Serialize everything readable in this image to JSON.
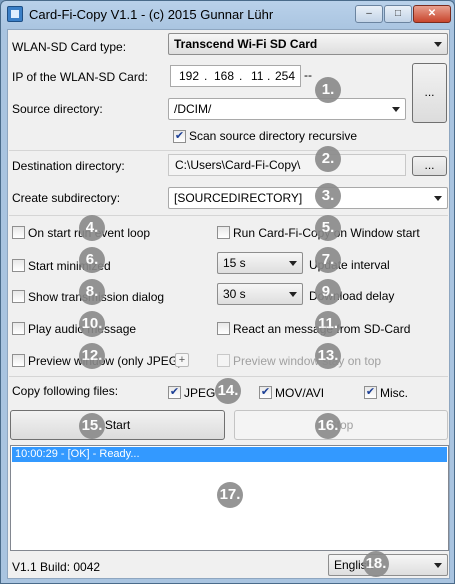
{
  "window": {
    "title": "Card-Fi-Copy V1.1 - (c) 2015 Gunnar Lühr"
  },
  "titlebar": {
    "minimize": "–",
    "maximize": "□",
    "close": "✕"
  },
  "card_type": {
    "label": "WLAN-SD Card type:",
    "value": "Transcend Wi-Fi SD Card"
  },
  "ip": {
    "label": "IP of the WLAN-SD Card:",
    "octets": [
      "192",
      "168",
      "11",
      "254"
    ],
    "dots": ".",
    "suffix": "--"
  },
  "side_button": {
    "label": "..."
  },
  "source": {
    "label": "Source directory:",
    "value": "/DCIM/"
  },
  "scan_recursive": {
    "label": "Scan source directory recursive",
    "checked": true
  },
  "destination": {
    "label": "Destination directory:",
    "value": "C:\\Users\\Card-Fi-Copy\\",
    "browse_label": "..."
  },
  "subdir": {
    "label": "Create subdirectory:",
    "value": "[SOURCEDIRECTORY]"
  },
  "options": {
    "event_loop": {
      "label": "On start run event loop",
      "checked": false
    },
    "run_on_start": {
      "label": "Run Card-Fi-Copy on Window start",
      "checked": false
    },
    "start_minimized": {
      "label": "Start minimized",
      "checked": false
    },
    "update_interval": {
      "value": "15 s",
      "label": "Update interval"
    },
    "show_dialog": {
      "label": "Show transmission dialog",
      "checked": false
    },
    "download_delay": {
      "value": "30 s",
      "label": "Download delay"
    },
    "play_audio": {
      "label": "Play audio message",
      "checked": false
    },
    "react_message": {
      "label": "React an message from SD-Card",
      "checked": false
    },
    "preview_window": {
      "label": "Preview window (only JPEG)",
      "checked": false,
      "plus": "+"
    },
    "preview_on_top": {
      "label": "Preview window stay on top",
      "checked": false
    }
  },
  "copy_files": {
    "label": "Copy following files:",
    "jpeg": {
      "label": "JPEG",
      "checked": true
    },
    "mov": {
      "label": "MOV/AVI",
      "checked": true
    },
    "misc": {
      "label": "Misc.",
      "checked": true
    }
  },
  "actions": {
    "start": "Start",
    "stop": "Stop"
  },
  "log": {
    "entries": [
      "10:00:29 - [OK] - Ready..."
    ]
  },
  "footer": {
    "build": "V1.1 Build: 0042",
    "language": "English"
  },
  "badges": [
    "1.",
    "2.",
    "3.",
    "4.",
    "5.",
    "6.",
    "7.",
    "8.",
    "9.",
    "10.",
    "11.",
    "12.",
    "13.",
    "14.",
    "15.",
    "16.",
    "17.",
    "18."
  ]
}
